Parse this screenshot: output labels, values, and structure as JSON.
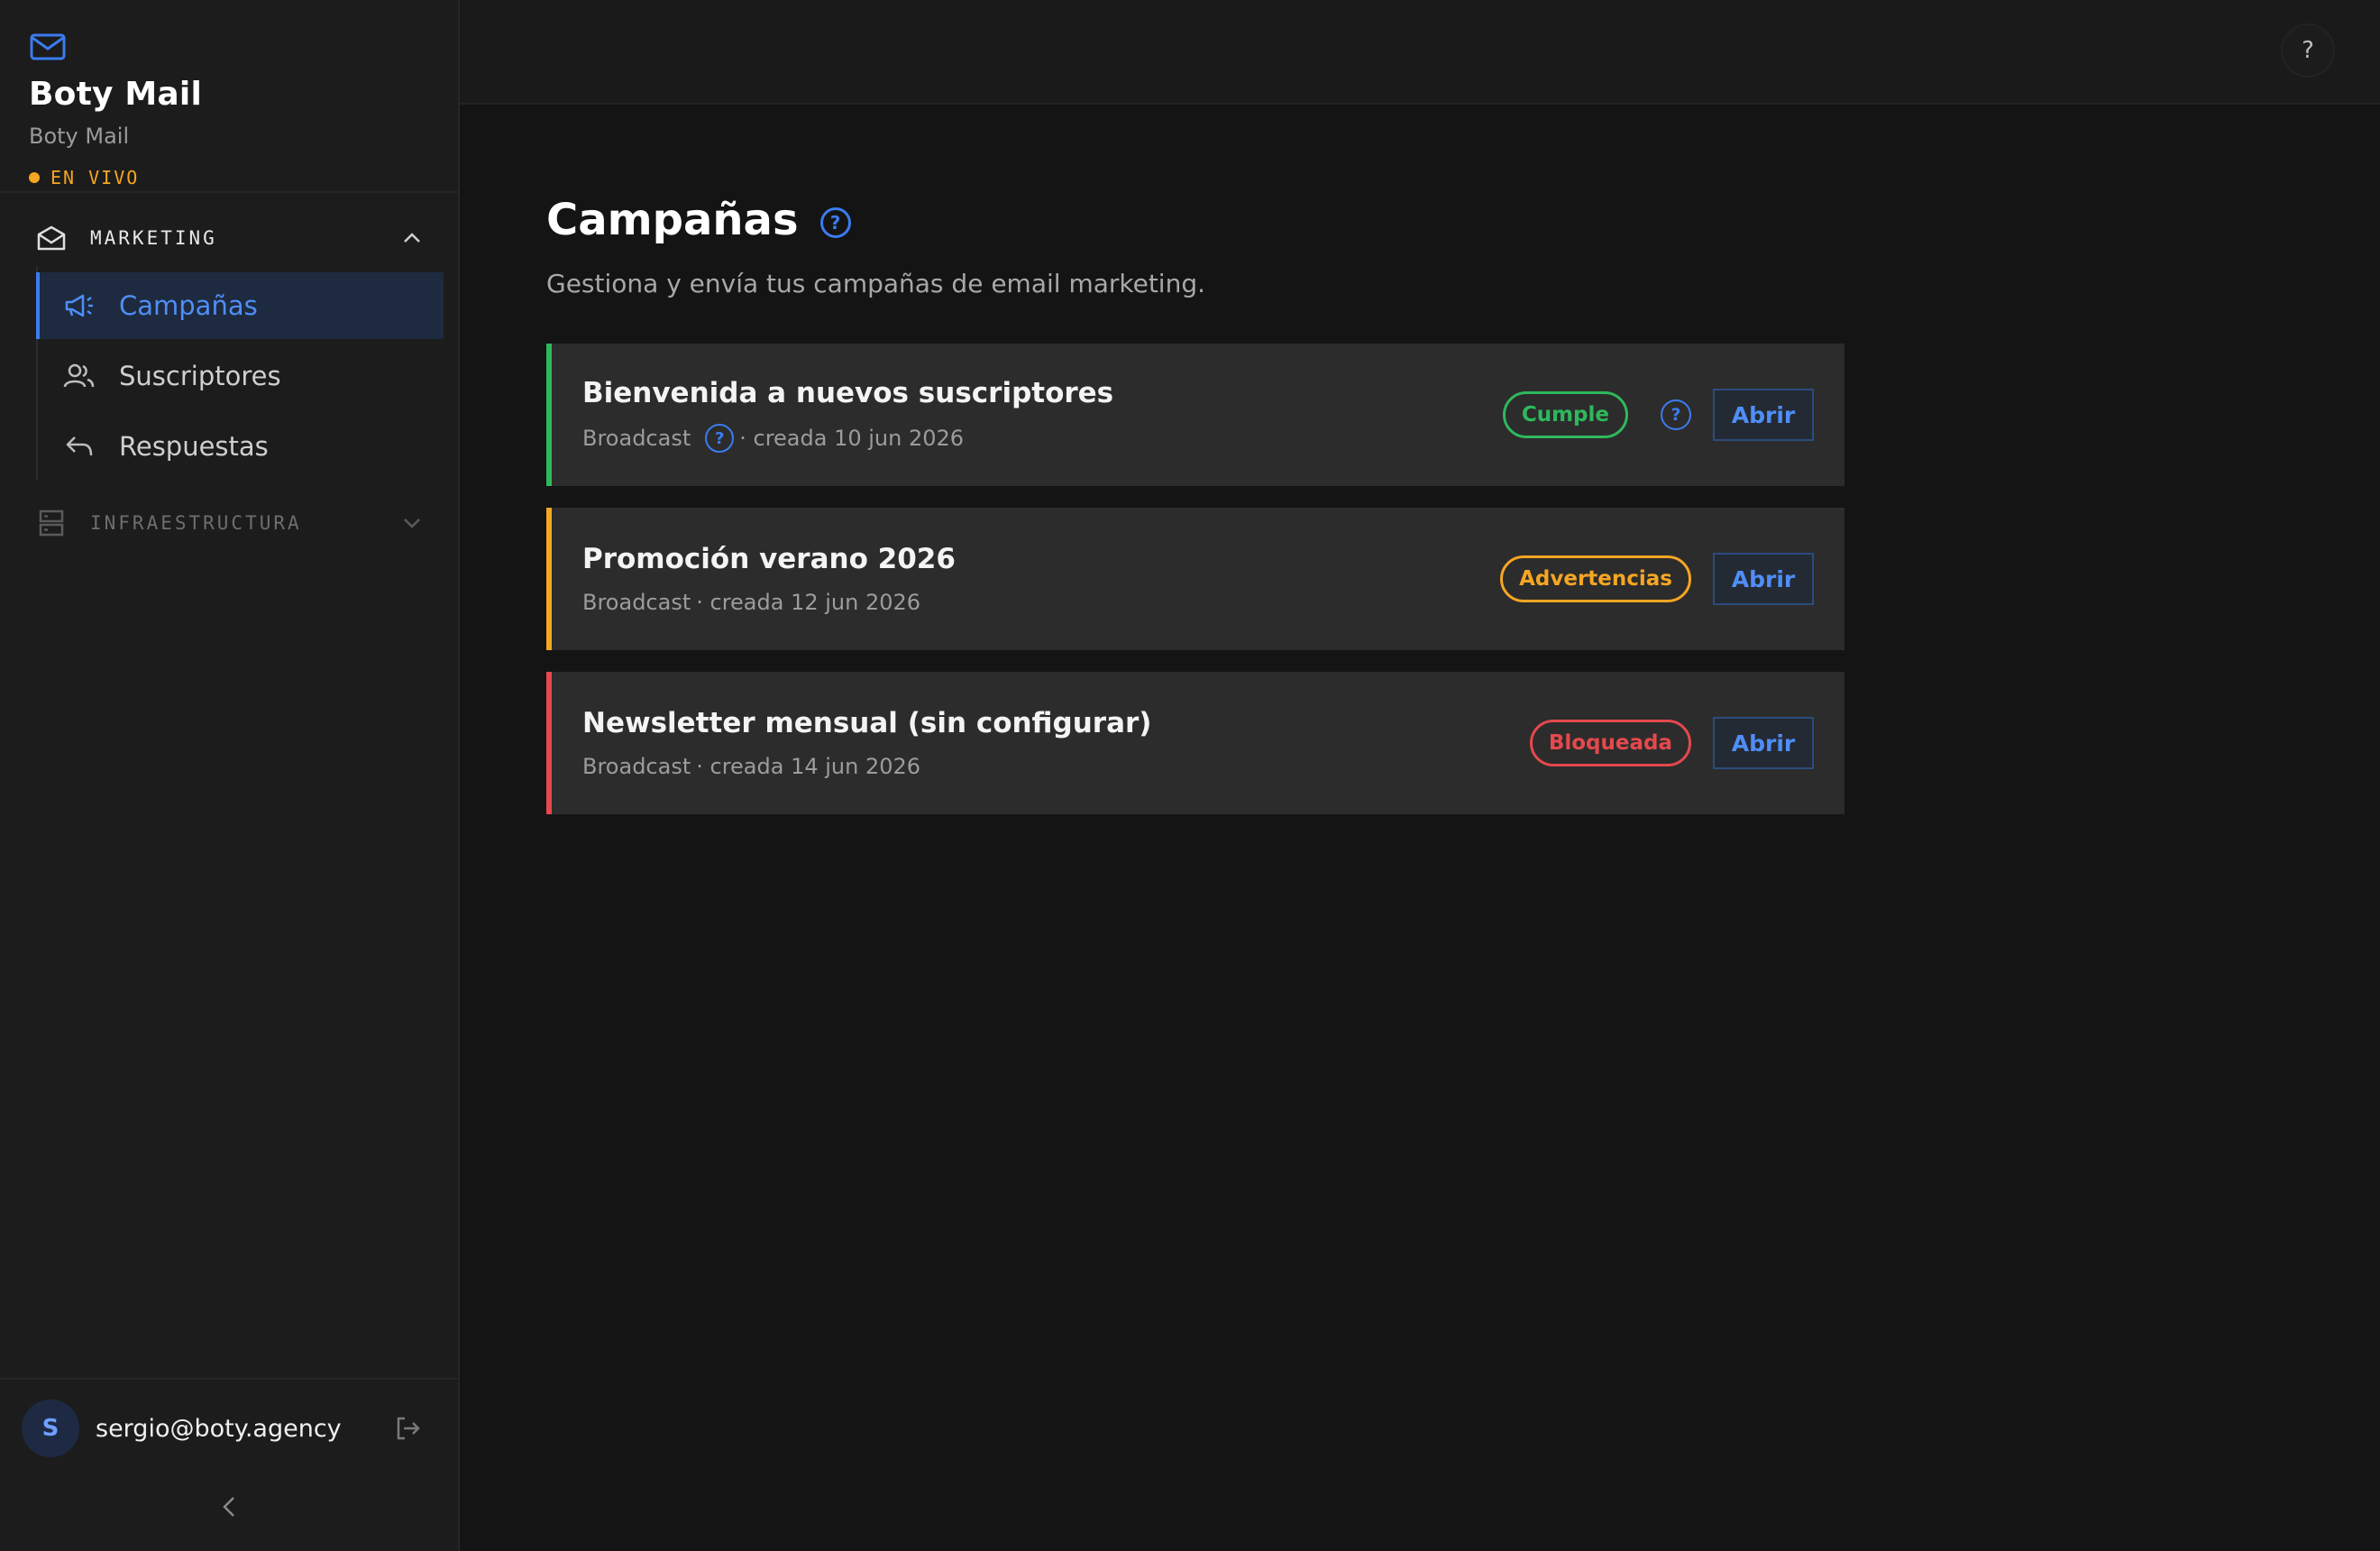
{
  "brand": {
    "title": "Boty Mail",
    "subtitle": "Boty Mail",
    "status": "EN VIVO",
    "status_color": "#f5a623",
    "icon": "envelope-icon"
  },
  "sidebar": {
    "sections": [
      {
        "label": "MARKETING",
        "icon": "mail-open-icon",
        "expanded": true,
        "items": [
          {
            "label": "Campañas",
            "icon": "megaphone-icon",
            "active": true
          },
          {
            "label": "Suscriptores",
            "icon": "users-icon",
            "active": false
          },
          {
            "label": "Respuestas",
            "icon": "reply-icon",
            "active": false
          }
        ]
      },
      {
        "label": "INFRAESTRUCTURA",
        "icon": "server-icon",
        "expanded": false,
        "items": []
      }
    ],
    "user": {
      "initial": "S",
      "email": "sergio@boty.agency"
    }
  },
  "header": {
    "help_label": "?"
  },
  "page": {
    "title": "Campañas",
    "subtitle": "Gestiona y envía tus campañas de email marketing.",
    "help_label": "?"
  },
  "campaigns": [
    {
      "name": "Bienvenida a nuevos suscriptores",
      "type": "Broadcast",
      "created": "· creada 10 jun 2026",
      "status": "Cumple",
      "status_color": "#2eb85c",
      "action": "Abrir",
      "has_help": true
    },
    {
      "name": "Promoción verano 2026",
      "type": "Broadcast",
      "created": "· creada 12 jun 2026",
      "status": "Advertencias",
      "status_color": "#f5a623",
      "action": "Abrir",
      "has_help": false
    },
    {
      "name": "Newsletter mensual (sin configurar)",
      "type": "Broadcast",
      "created": "· creada 14 jun 2026",
      "status": "Bloqueada",
      "status_color": "#e5484d",
      "action": "Abrir",
      "has_help": false
    }
  ],
  "colors": {
    "accent": "#3b7cf0",
    "background": "#141414",
    "sidebar": "#1c1c1c",
    "card": "#2c2c2c"
  }
}
